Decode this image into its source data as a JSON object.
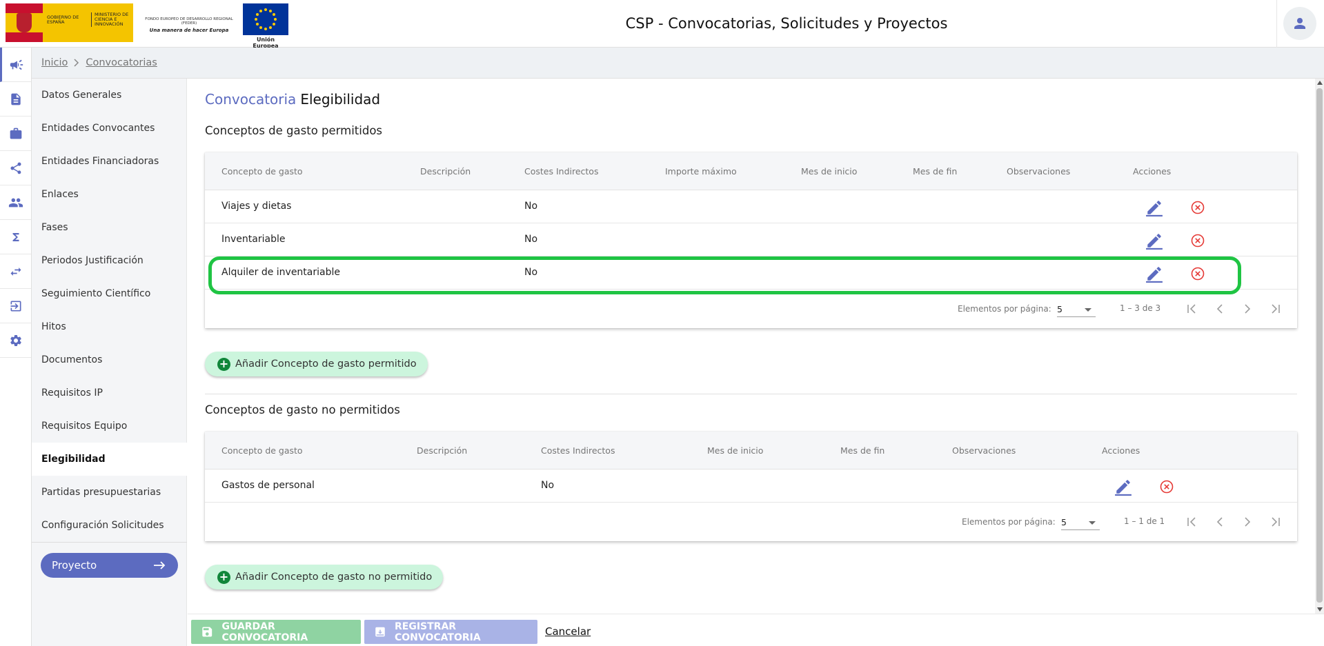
{
  "header": {
    "title": "CSP - Convocatorias, Solicitudes y Proyectos",
    "logos": {
      "gobierno": "GOBIERNO DE ESPAÑA",
      "ministerio": "MINISTERIO DE CIENCIA E INNOVACIÓN",
      "feder_line1": "FONDO EUROPEO DE DESARROLLO REGIONAL (FEDER)",
      "feder_line2": "Una manera de hacer Europa",
      "ue": "Unión Europea"
    },
    "user_icon": "person-icon"
  },
  "rail": {
    "items": [
      {
        "icon": "megaphone-icon",
        "active": true
      },
      {
        "icon": "document-icon",
        "active": false
      },
      {
        "icon": "briefcase-icon",
        "active": false
      },
      {
        "icon": "share-icon",
        "active": false
      },
      {
        "icon": "people-icon",
        "active": false
      },
      {
        "icon": "sigma-icon",
        "active": false
      },
      {
        "icon": "swap-icon",
        "active": false
      },
      {
        "icon": "logout-icon",
        "active": false
      },
      {
        "icon": "gear-icon",
        "active": false
      }
    ]
  },
  "breadcrumb": {
    "items": [
      "Inicio",
      "Convocatorias"
    ]
  },
  "subnav": {
    "items": [
      "Datos Generales",
      "Entidades Convocantes",
      "Entidades Financiadoras",
      "Enlaces",
      "Fases",
      "Periodos Justificación",
      "Seguimiento Científico",
      "Hitos",
      "Documentos",
      "Requisitos IP",
      "Requisitos Equipo",
      "Elegibilidad",
      "Partidas presupuestarias",
      "Configuración Solicitudes"
    ],
    "active_index": 11,
    "proyecto_label": "Proyecto"
  },
  "main": {
    "heading_entity": "Convocatoria",
    "heading_section": "Elegibilidad",
    "permitidos": {
      "title": "Conceptos de gasto permitidos",
      "columns": [
        "Concepto de gasto",
        "Descripción",
        "Costes Indirectos",
        "Importe máximo",
        "Mes de inicio",
        "Mes de fin",
        "Observaciones",
        "Acciones"
      ],
      "rows": [
        {
          "concepto": "Viajes y dietas",
          "costes": "No"
        },
        {
          "concepto": "Inventariable",
          "costes": "No"
        },
        {
          "concepto": "Alquiler de inventariable",
          "costes": "No"
        }
      ],
      "paginator": {
        "label": "Elementos por página:",
        "page_size": "5",
        "range": "1 – 3 de 3"
      },
      "add_label": "Añadir Concepto de gasto permitido"
    },
    "no_permitidos": {
      "title": "Conceptos de gasto no permitidos",
      "columns": [
        "Concepto de gasto",
        "Descripción",
        "Costes Indirectos",
        "Mes de inicio",
        "Mes de fin",
        "Observaciones",
        "Acciones"
      ],
      "rows": [
        {
          "concepto": "Gastos de personal",
          "costes": "No"
        }
      ],
      "paginator": {
        "label": "Elementos por página:",
        "page_size": "5",
        "range": "1 – 1 de 1"
      },
      "add_label": "Añadir Concepto de gasto no permitido"
    }
  },
  "footer": {
    "save_label": "GUARDAR CONVOCATORIA",
    "register_label": "REGISTRAR CONVOCATORIA",
    "cancel_label": "Cancelar"
  },
  "colors": {
    "primary": "#5c6bc0",
    "danger": "#e53935",
    "add_bg": "#ccf5dd",
    "add_icon": "#11863a",
    "highlight": "#1fc443"
  }
}
